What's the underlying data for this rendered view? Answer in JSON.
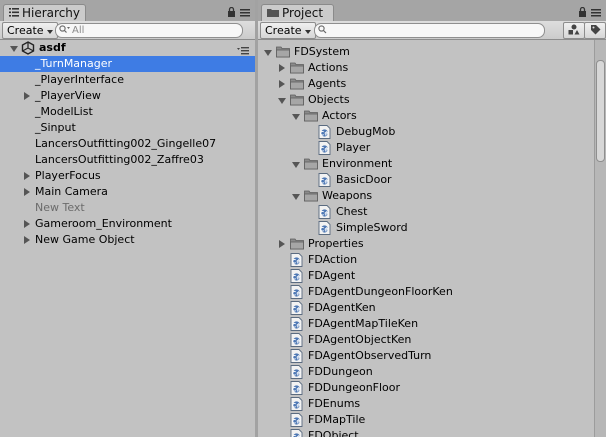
{
  "hierarchy": {
    "tab_label": "Hierarchy",
    "create_label": "Create",
    "search_placeholder": "All",
    "scene_name": "asdf",
    "items": [
      {
        "label": "_TurnManager",
        "selected": true,
        "expandable": false,
        "dim": false
      },
      {
        "label": "_PlayerInterface",
        "selected": false,
        "expandable": false,
        "dim": false
      },
      {
        "label": "_PlayerView",
        "selected": false,
        "expandable": true,
        "dim": false
      },
      {
        "label": "_ModelList",
        "selected": false,
        "expandable": false,
        "dim": false
      },
      {
        "label": "_Sinput",
        "selected": false,
        "expandable": false,
        "dim": false
      },
      {
        "label": "LancersOutfitting002_Gingelle07",
        "selected": false,
        "expandable": false,
        "dim": false
      },
      {
        "label": "LancersOutfitting002_Zaffre03",
        "selected": false,
        "expandable": false,
        "dim": false
      },
      {
        "label": "PlayerFocus",
        "selected": false,
        "expandable": true,
        "dim": false
      },
      {
        "label": "Main Camera",
        "selected": false,
        "expandable": true,
        "dim": false
      },
      {
        "label": "New Text",
        "selected": false,
        "expandable": false,
        "dim": true
      },
      {
        "label": "Gameroom_Environment",
        "selected": false,
        "expandable": true,
        "dim": false
      },
      {
        "label": "New Game Object",
        "selected": false,
        "expandable": true,
        "dim": false
      }
    ]
  },
  "project": {
    "tab_label": "Project",
    "create_label": "Create",
    "search_value": "",
    "items": [
      {
        "label": "FDSystem",
        "type": "folder",
        "depth": 0,
        "arrow": "down"
      },
      {
        "label": "Actions",
        "type": "folder",
        "depth": 1,
        "arrow": "right"
      },
      {
        "label": "Agents",
        "type": "folder",
        "depth": 1,
        "arrow": "right"
      },
      {
        "label": "Objects",
        "type": "folder",
        "depth": 1,
        "arrow": "down"
      },
      {
        "label": "Actors",
        "type": "folder",
        "depth": 2,
        "arrow": "down"
      },
      {
        "label": "DebugMob",
        "type": "script",
        "depth": 3,
        "arrow": "none"
      },
      {
        "label": "Player",
        "type": "script",
        "depth": 3,
        "arrow": "none"
      },
      {
        "label": "Environment",
        "type": "folder",
        "depth": 2,
        "arrow": "down"
      },
      {
        "label": "BasicDoor",
        "type": "script",
        "depth": 3,
        "arrow": "none"
      },
      {
        "label": "Weapons",
        "type": "folder",
        "depth": 2,
        "arrow": "down"
      },
      {
        "label": "Chest",
        "type": "script",
        "depth": 3,
        "arrow": "none"
      },
      {
        "label": "SimpleSword",
        "type": "script",
        "depth": 3,
        "arrow": "none"
      },
      {
        "label": "Properties",
        "type": "folder",
        "depth": 1,
        "arrow": "right"
      },
      {
        "label": "FDAction",
        "type": "script",
        "depth": 1,
        "arrow": "none"
      },
      {
        "label": "FDAgent",
        "type": "script",
        "depth": 1,
        "arrow": "none"
      },
      {
        "label": "FDAgentDungeonFloorKen",
        "type": "script",
        "depth": 1,
        "arrow": "none"
      },
      {
        "label": "FDAgentKen",
        "type": "script",
        "depth": 1,
        "arrow": "none"
      },
      {
        "label": "FDAgentMapTileKen",
        "type": "script",
        "depth": 1,
        "arrow": "none"
      },
      {
        "label": "FDAgentObjectKen",
        "type": "script",
        "depth": 1,
        "arrow": "none"
      },
      {
        "label": "FDAgentObservedTurn",
        "type": "script",
        "depth": 1,
        "arrow": "none"
      },
      {
        "label": "FDDungeon",
        "type": "script",
        "depth": 1,
        "arrow": "none"
      },
      {
        "label": "FDDungeonFloor",
        "type": "script",
        "depth": 1,
        "arrow": "none"
      },
      {
        "label": "FDEnums",
        "type": "script",
        "depth": 1,
        "arrow": "none"
      },
      {
        "label": "FDMapTile",
        "type": "script",
        "depth": 1,
        "arrow": "none"
      },
      {
        "label": "FDObject",
        "type": "script",
        "depth": 1,
        "arrow": "none"
      }
    ]
  },
  "colors": {
    "selection": "#3e7ce4",
    "panel": "#c2c2c2",
    "divider": "#a2a2a2"
  }
}
